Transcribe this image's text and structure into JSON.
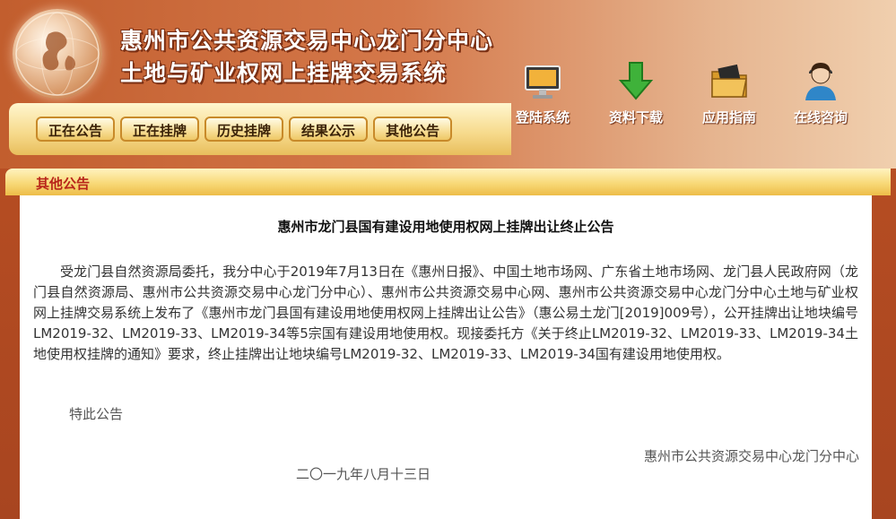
{
  "header": {
    "title_line1": "惠州市公共资源交易中心龙门分中心",
    "title_line2": "土地与矿业权网上挂牌交易系统"
  },
  "nav": {
    "items": [
      {
        "label": "正在公告"
      },
      {
        "label": "正在挂牌"
      },
      {
        "label": "历史挂牌"
      },
      {
        "label": "结果公示"
      },
      {
        "label": "其他公告"
      }
    ]
  },
  "quick_links": [
    {
      "label": "登陆系统",
      "icon": "monitor-icon"
    },
    {
      "label": "资料下载",
      "icon": "download-arrow-icon"
    },
    {
      "label": "应用指南",
      "icon": "folder-icon"
    },
    {
      "label": "在线咨询",
      "icon": "support-agent-icon"
    }
  ],
  "section": {
    "title": "其他公告"
  },
  "notice": {
    "title": "惠州市龙门县国有建设用地使用权网上挂牌出让终止公告",
    "body": "受龙门县自然资源局委托，我分中心于2019年7月13日在《惠州日报》、中国土地市场网、广东省土地市场网、龙门县人民政府网（龙门县自然资源局、惠州市公共资源交易中心龙门分中心）、惠州市公共资源交易中心网、惠州市公共资源交易中心龙门分中心土地与矿业权网上挂牌交易系统上发布了《惠州市龙门县国有建设用地使用权网上挂牌出让公告》（惠公易土龙门[2019]009号），公开挂牌出让地块编号LM2019-32、LM2019-33、LM2019-34等5宗国有建设用地使用权。现接委托方《关于终止LM2019-32、LM2019-33、LM2019-34土地使用权挂牌的通知》要求，终止挂牌出让地块编号LM2019-32、LM2019-33、LM2019-34国有建设用地使用权。",
    "closing": "特此公告",
    "organization": "惠州市公共资源交易中心龙门分中心",
    "date": "二〇一九年八月十三日"
  },
  "colors": {
    "header_orange": "#c25e2e",
    "nav_gold": "#f6d98a",
    "section_title_red": "#b8251a"
  }
}
